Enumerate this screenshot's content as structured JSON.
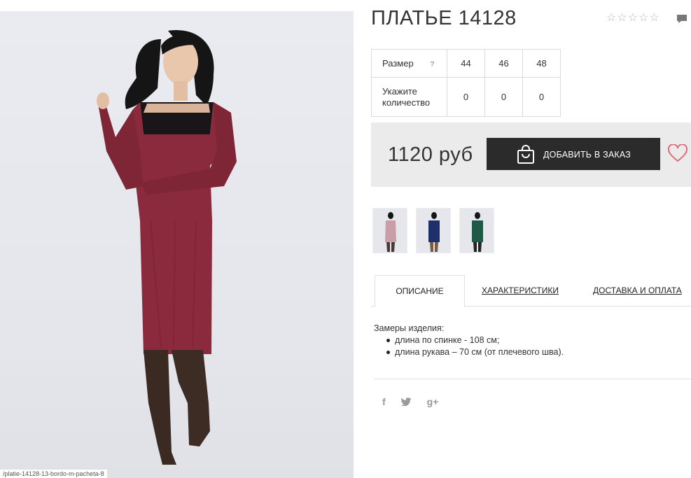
{
  "product": {
    "title": "ПЛАТЬЕ 14128",
    "photo_caption": "/platie-14128-13-bordo-m-pacheta-8",
    "rating_stars": [
      "☆",
      "☆",
      "☆",
      "☆",
      "☆"
    ]
  },
  "size_table": {
    "size_label": "Размер",
    "help_mark": "?",
    "sizes": [
      "44",
      "46",
      "48"
    ],
    "qty_label": "Укажите количество",
    "quantities": [
      "0",
      "0",
      "0"
    ]
  },
  "buy": {
    "price": "1120 руб",
    "add_button_label": "ДОБАВИТЬ В ЗАКАЗ"
  },
  "tabs": [
    {
      "label": "ОПИСАНИЕ"
    },
    {
      "label": "ХАРАКТЕРИСТИКИ"
    },
    {
      "label": "ДОСТАВКА И ОПЛАТА"
    }
  ],
  "description": {
    "heading": "Замеры изделия:",
    "items": [
      "длина по спинке - 108 см;",
      "длина рукава – 70 см (от плечевого шва)."
    ]
  },
  "social": {
    "facebook": "f",
    "twitter": "🐦",
    "google": "g+"
  },
  "colors": {
    "dress_burgundy": "#8a2a3c",
    "dress_navy": "#1f2f6b",
    "dress_green": "#1d5a45",
    "button_dark": "#2b2b2b",
    "heart_pink": "#e06a7a"
  }
}
